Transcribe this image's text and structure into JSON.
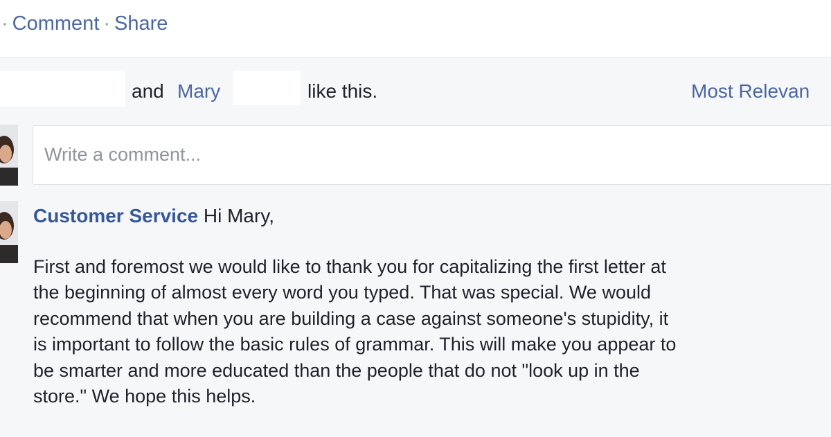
{
  "action_bar": {
    "separator_lead": "·",
    "comment_label": "Comment",
    "separator": "·",
    "share_label": "Share"
  },
  "likes": {
    "and_text": "and",
    "person_name": "Mary",
    "suffix_text": "like this.",
    "sort_label": "Most Relevan"
  },
  "composer": {
    "placeholder": "Write a comment..."
  },
  "comment": {
    "author": "Customer Service",
    "greeting": "Hi Mary,",
    "body_lines": [
      "First and foremost we would like to thank you for capitalizing the first letter at",
      "the beginning of almost every word you typed. That was special. We would",
      "recommend that when you are building a case against someone's stupidity, it",
      "is important to follow the basic rules of grammar. This will make you appear to",
      "be smarter and more educated than the people that do not \"look up in the",
      "store.\" We hope this helps."
    ]
  }
}
